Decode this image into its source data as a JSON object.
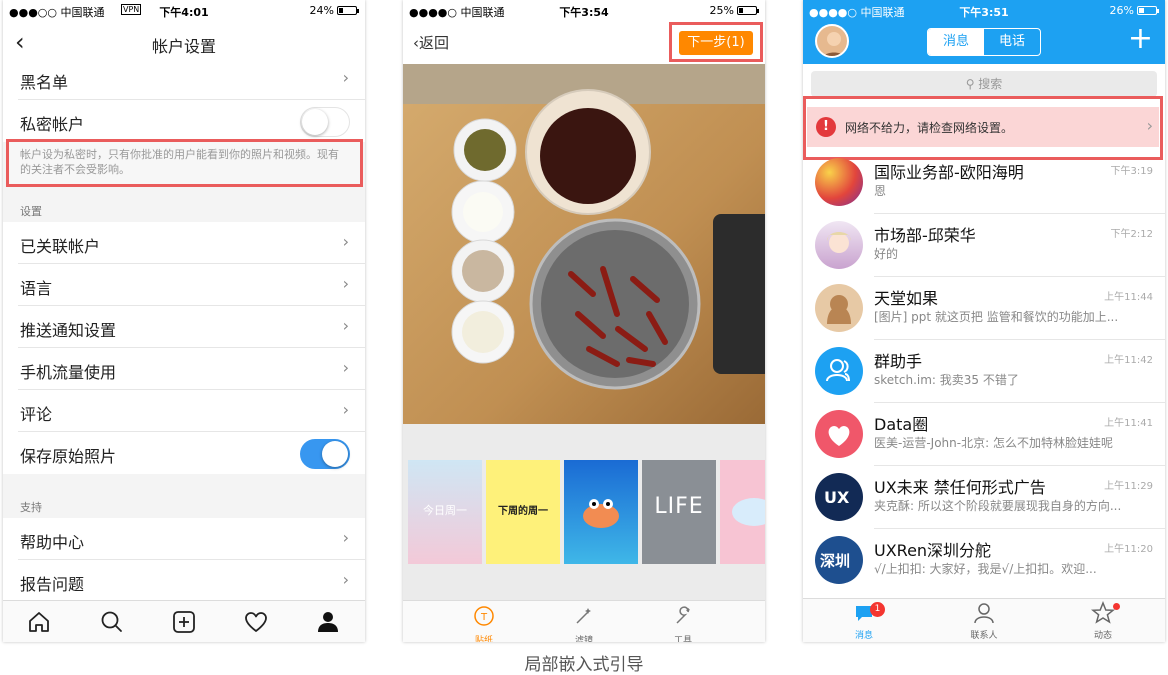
{
  "caption": "局部嵌入式引导",
  "phone1": {
    "status": {
      "carrier": "●●●○○ 中国联通",
      "vpn": "VPN",
      "time": "下午4:01",
      "battery": "24%"
    },
    "nav": {
      "back": "‹",
      "title": "帐户设置"
    },
    "rows": {
      "blacklist": "黑名单",
      "private": "私密帐户",
      "note": "帐户设为私密时，只有你批准的用户能看到你的照片和视频。现有的关注者不会受影响。",
      "section_settings": "设置",
      "linked": "已关联帐户",
      "language": "语言",
      "push": "推送通知设置",
      "data": "手机流量使用",
      "comments": "评论",
      "save_photos": "保存原始照片",
      "section_support": "支持",
      "help": "帮助中心",
      "report": "报告问题"
    }
  },
  "phone2": {
    "status": {
      "carrier": "●●●●○ 中国联通",
      "time": "下午3:54",
      "battery": "25%"
    },
    "nav": {
      "back": "‹返回",
      "next": "下一步(1)"
    },
    "thumbs": [
      "今日周一",
      "下周的周一",
      "",
      "LIFE",
      ""
    ],
    "tabs": {
      "sticker": "贴纸",
      "filter": "滤镜",
      "tools": "工具"
    }
  },
  "phone3": {
    "status": {
      "carrier": "●●●●○ 中国联通",
      "time": "下午3:51",
      "battery": "26%"
    },
    "segments": {
      "messages": "消息",
      "calls": "电话"
    },
    "search_placeholder": "搜索",
    "alert": "网络不给力，请检查网络设置。",
    "chats": [
      {
        "name": "国际业务部-欧阳海明",
        "msg": "恩",
        "time": "下午3:19"
      },
      {
        "name": "市场部-邱荣华",
        "msg": "好的",
        "time": "下午2:12"
      },
      {
        "name": "天堂如果",
        "msg": "[图片] ppt 就这页把  监管和餐饮的功能加上...",
        "time": "上午11:44"
      },
      {
        "name": "群助手",
        "msg": "sketch.im: 我卖35 不错了",
        "time": "上午11:42"
      },
      {
        "name": "Data圈",
        "msg": "医美-运营-John-北京: 怎么不加特林脸娃娃呢",
        "time": "上午11:41"
      },
      {
        "name": "UX未来 禁任何形式广告",
        "msg": "夹克酥: 所以这个阶段就要展现我自身的方向...",
        "time": "上午11:29"
      },
      {
        "name": "UXRen深圳分舵",
        "msg": "√/上扣扣: 大家好，我是√/上扣扣。欢迎...",
        "time": "上午11:20"
      }
    ],
    "tabs": {
      "messages": "消息",
      "contacts": "联系人",
      "moments": "动态"
    },
    "unread_badge": "1",
    "colors": {
      "accent": "#1da1f2",
      "alert_bg": "#fbd6d6",
      "highlight": "#ea5c5c"
    }
  }
}
